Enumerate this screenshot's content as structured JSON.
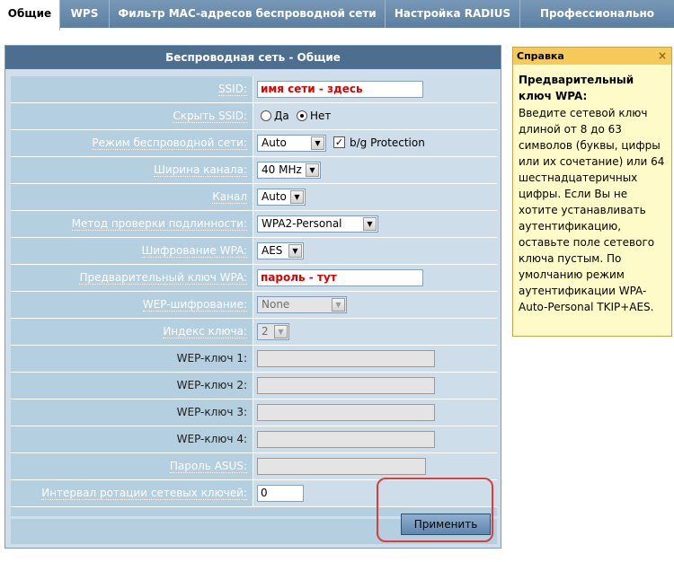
{
  "tabs": [
    "Общие",
    "WPS",
    "Фильтр MAC-адресов беспроводной сети",
    "Настройка RADIUS",
    "Профессионально"
  ],
  "panel": {
    "title": "Беспроводная сеть - Общие"
  },
  "form": {
    "ssid_label": "SSID:",
    "ssid_value": "имя сети - здесь",
    "hide_ssid_label": "Скрыть SSID:",
    "hide_yes": "Да",
    "hide_no": "Нет",
    "mode_label": "Режим беспроводной сети:",
    "mode_value": "Auto",
    "bg_protection": "b/g Protection",
    "width_label": "Ширина канала:",
    "width_value": "40 MHz",
    "channel_label": "Канал",
    "channel_value": "Auto",
    "auth_label": "Метод проверки подлинности:",
    "auth_value": "WPA2-Personal",
    "wpa_enc_label": "Шифрование WPA:",
    "wpa_enc_value": "AES",
    "psk_label": "Предварительный ключ WPA:",
    "psk_value": "пароль - тут",
    "wep_enc_label": "WEP-шифрование:",
    "wep_enc_value": "None",
    "key_index_label": "Индекс ключа:",
    "key_index_value": "2",
    "wep1_label": "WEP-ключ 1:",
    "wep2_label": "WEP-ключ 2:",
    "wep3_label": "WEP-ключ 3:",
    "wep4_label": "WEP-ключ 4:",
    "asus_pass_label": "Пароль ASUS:",
    "rotation_label": "Интервал ротации сетевых ключей:",
    "rotation_value": "0",
    "apply": "Применить"
  },
  "help": {
    "head": "Справка",
    "close": "×",
    "title": "Предварительный ключ WPA:",
    "body": "Введите сетевой ключ длиной от 8 до 63 символов (буквы, цифры или их сочетание) или 64 шестнадцатеричных цифры. Если Вы не хотите устанавливать аутентификацию, оставьте поле сетевого ключа пустым. По умолчанию режим аутентификации WPA-Auto-Personal TKIP+AES."
  },
  "colors": {
    "tab_bar": "#5a7fa1",
    "panel_header": "#4e6e8f",
    "form_bg": "#b3cfe0",
    "help_bg": "#fffbc8",
    "help_head": "#f5c95a",
    "highlight": "#e03a3a",
    "red_text": "#e00000"
  }
}
